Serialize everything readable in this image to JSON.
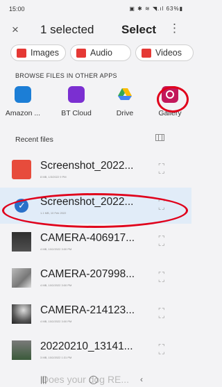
{
  "status": {
    "time": "15:00",
    "icons": "▣ ✱ ≋ ◥.ıl 63%▮",
    "icons_names": [
      "notification-icon",
      "bluetooth-icon",
      "wifi-icon",
      "signal-icon",
      "battery-icon"
    ]
  },
  "appbar": {
    "close": "×",
    "title": "1 selected",
    "select": "Select",
    "more": "⋮"
  },
  "chips": [
    {
      "label": "Images",
      "color": "#e53935"
    },
    {
      "label": "Audio",
      "color": "#e53935"
    },
    {
      "label": "Videos",
      "color": "#e53935"
    }
  ],
  "section_label": "BROWSE FILES IN OTHER APPS",
  "apps": [
    {
      "label": "Amazon ..."
    },
    {
      "label": "BT Cloud"
    },
    {
      "label": "Drive"
    },
    {
      "label": "Gallery"
    }
  ],
  "recent_label": "Recent files",
  "files": [
    {
      "name": "Screenshot_2022...",
      "meta": "8 MB, 1/3/2022 9 PM"
    },
    {
      "name": "Screenshot_2022...",
      "meta": "1.1 MB, 10 Feb 2022"
    },
    {
      "name": "CAMERA-406917...",
      "meta": "4 MB, 10/2/2022 3:00 PM"
    },
    {
      "name": "CAMERA-207998...",
      "meta": "4 MB, 10/2/2022 3:00 PM"
    },
    {
      "name": "CAMERA-214123...",
      "meta": "4 MB, 10/2/2022 3:00 PM"
    },
    {
      "name": "20220210_13141...",
      "meta": "3 MB, 10/2/2022 1:31 PM"
    },
    {
      "name": "Does your dog RE...",
      "meta": ""
    }
  ],
  "nav": {
    "recents": "|||",
    "home": "◯",
    "back": "‹"
  }
}
